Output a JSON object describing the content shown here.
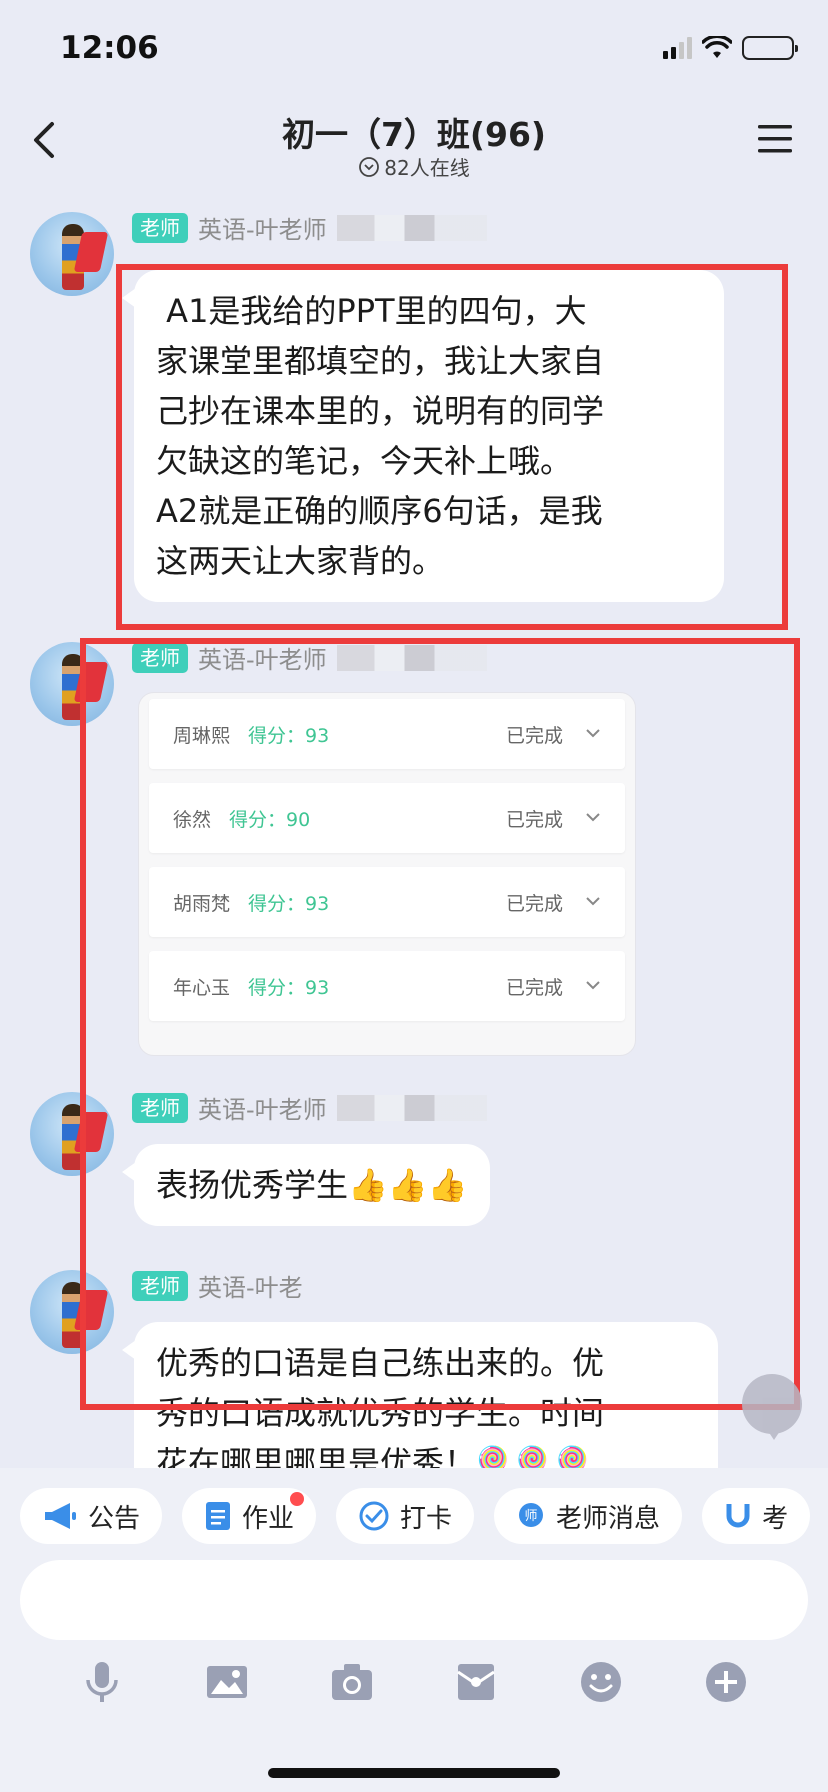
{
  "status_bar": {
    "time": "12:06"
  },
  "header": {
    "title": "初一（7）班(96)",
    "online": "82人在线"
  },
  "messages": [
    {
      "tag": "老师",
      "sender": "英语-叶老师",
      "text": " A1是我给的PPT里的四句，大\n家课堂里都填空的，我让大家自\n己抄在课本里的，说明有的同学\n欠缺这的笔记，今天补上哦。\nA2就是正确的顺序6句话，是我\n这两天让大家背的。"
    },
    {
      "tag": "老师",
      "sender": "英语-叶老师"
    },
    {
      "tag": "老师",
      "sender": "英语-叶老师",
      "text": "表扬优秀学生👍👍👍"
    },
    {
      "tag": "老师",
      "sender": "英语-叶老",
      "text": "优秀的口语是自己练出来的。优\n秀的口语成就优秀的学生。时间\n花在哪里哪里是优秀！🍭🍭🍭"
    }
  ],
  "results": [
    {
      "name": "周琳熙",
      "score": "得分：93",
      "status": "已完成"
    },
    {
      "name": "徐然",
      "score": "得分：90",
      "status": "已完成"
    },
    {
      "name": "胡雨梵",
      "score": "得分：93",
      "status": "已完成"
    },
    {
      "name": "年心玉",
      "score": "得分：93",
      "status": "已完成"
    }
  ],
  "quick_actions": [
    {
      "label": "公告",
      "icon": "megaphone-icon"
    },
    {
      "label": "作业",
      "icon": "document-icon",
      "badge": true
    },
    {
      "label": "打卡",
      "icon": "check-circle-icon"
    },
    {
      "label": "老师消息",
      "icon": "chat-bubble-icon"
    },
    {
      "label": "考",
      "icon": "magnet-icon"
    }
  ],
  "bottom_icons": [
    "microphone-icon",
    "image-icon",
    "camera-icon",
    "inbox-icon",
    "emoji-icon",
    "plus-circle-icon"
  ],
  "colors": {
    "teacher_tag": "#3fcfba",
    "score_green": "#3fc593",
    "annotation_red": "#ec3b3b",
    "badge_red": "#ff4d4f"
  }
}
